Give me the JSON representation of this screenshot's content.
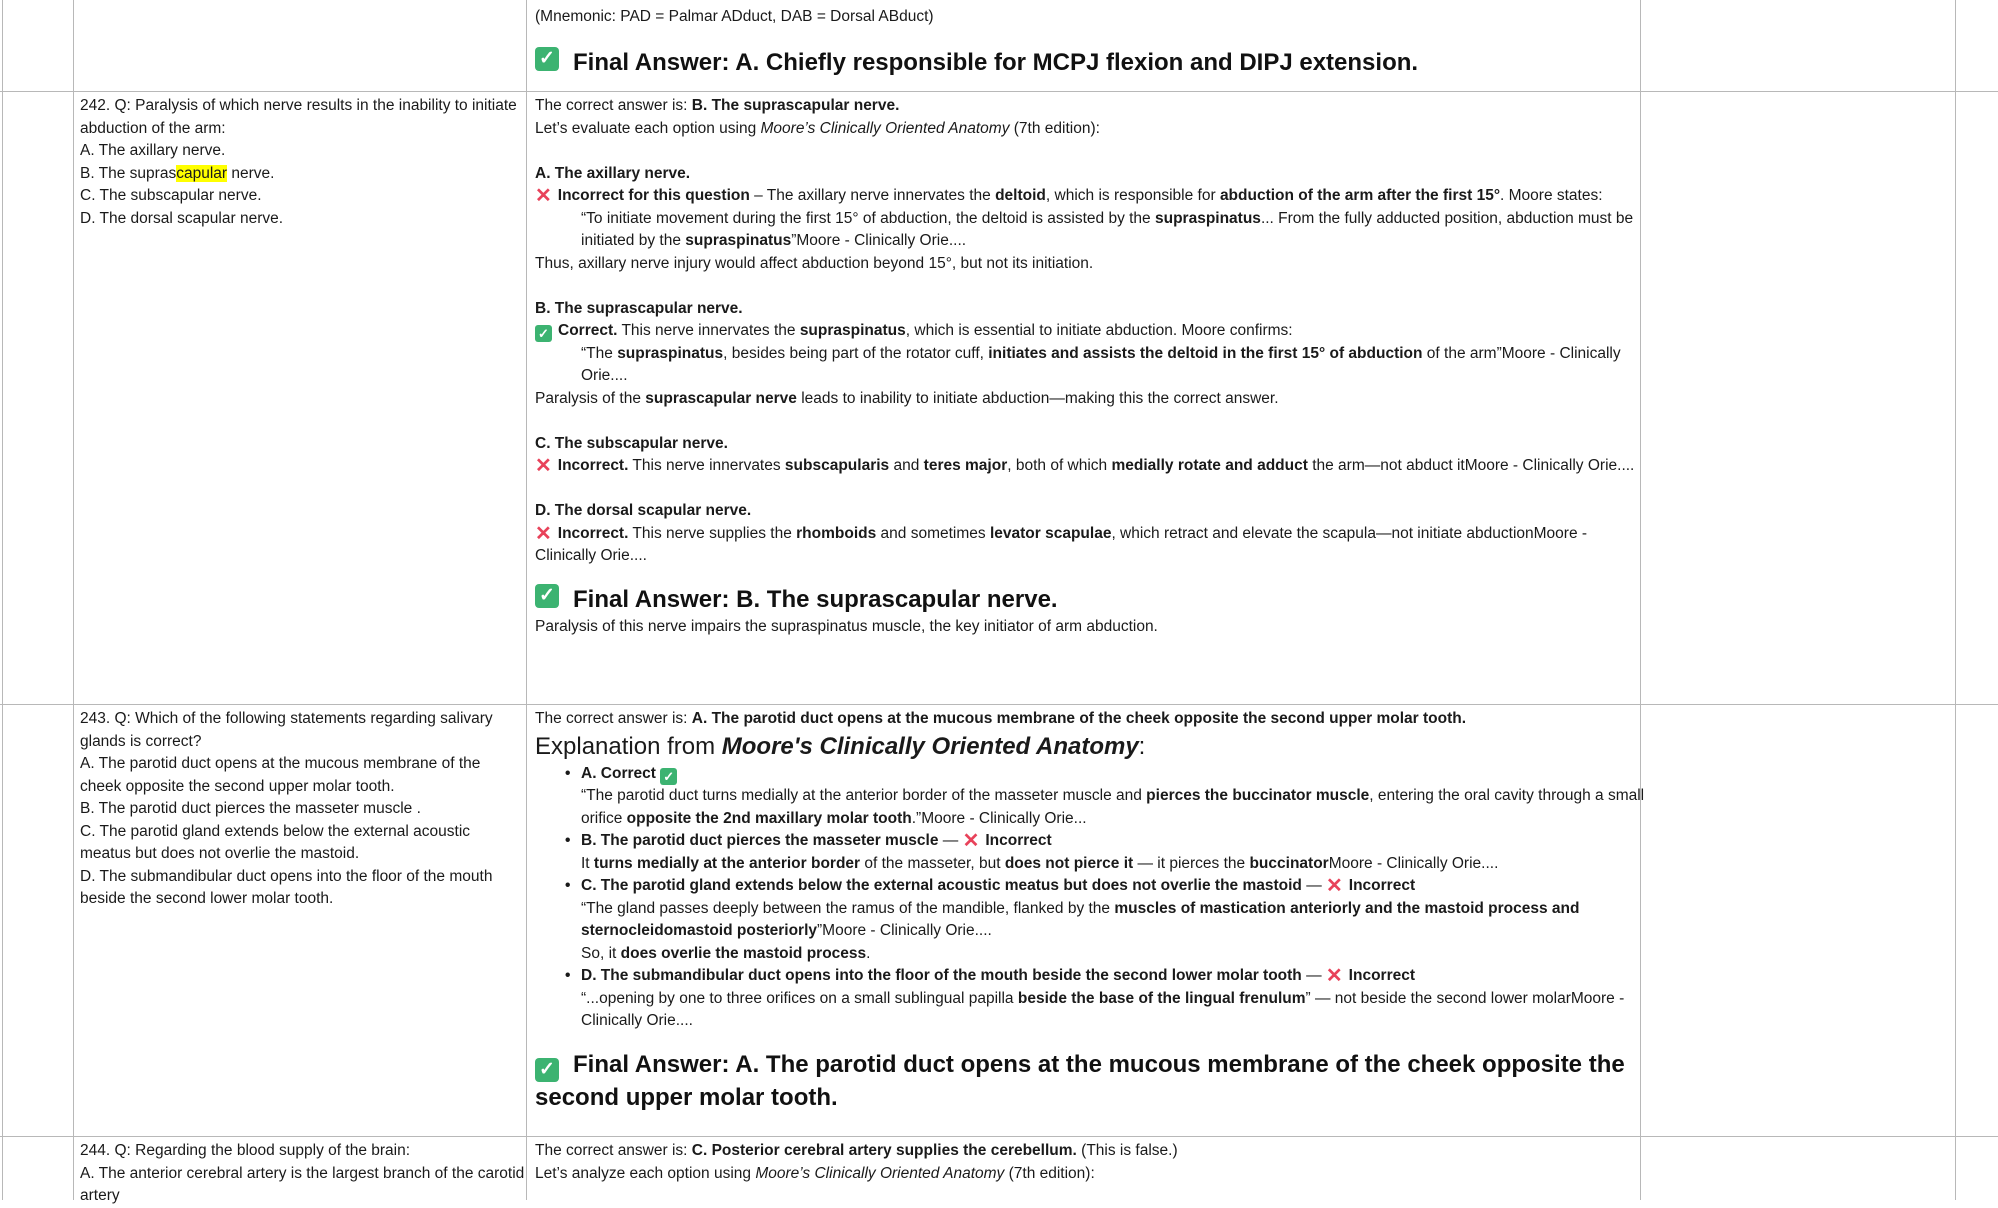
{
  "row241": {
    "mnemonic": "(Mnemonic: PAD = Palmar ADduct, DAB = Dorsal ABduct)",
    "final": "Final Answer: A. Chiefly responsible for MCPJ flexion and DIPJ extension."
  },
  "q242": {
    "stem": "242. Q: Paralysis of which nerve results in the inability to initiate abduction of the arm:",
    "opt_a": "A. The axillary nerve.",
    "opt_b_pre": "B. The supras",
    "opt_b_hl": "capular",
    "opt_b_post": " nerve.",
    "opt_c": "C. The subscapular nerve.",
    "opt_d": "D. The dorsal scapular nerve."
  },
  "a242": {
    "correct_pre": "The correct answer is: ",
    "correct_ans": "B. The suprascapular nerve.",
    "eval_pre": "Let’s evaluate each option using ",
    "eval_book": "Moore’s Clinically Oriented Anatomy",
    "eval_post": " (7th edition):",
    "a_head": "A. The axillary nerve.",
    "a_verdict": "Incorrect for this question",
    "a_t1": " – The axillary nerve innervates the ",
    "a_t2": "deltoid",
    "a_t3": ", which is responsible for ",
    "a_t4": "abduction of the arm after the first 15°",
    "a_t5": ". Moore states:",
    "a_q1": "“To initiate movement during the first 15° of abduction, the deltoid is assisted by the ",
    "a_q2": "supraspinatus",
    "a_q3": "... From the fully adducted position, abduction must be initiated by the ",
    "a_q4": "supraspinatus",
    "a_q5": "”Moore - Clinically Orie....",
    "a_thus": "Thus, axillary nerve injury would affect abduction beyond 15°, but not its initiation.",
    "b_head": "B. The suprascapular nerve.",
    "b_verdict": "Correct.",
    "b_t1": " This nerve innervates the ",
    "b_t2": "supraspinatus",
    "b_t3": ", which is essential to initiate abduction. Moore confirms:",
    "b_q1": "“The ",
    "b_q2": "supraspinatus",
    "b_q3": ", besides being part of the rotator cuff, ",
    "b_q4": "initiates and assists the deltoid in the first 15° of abduction",
    "b_q5": " of the arm”Moore - Clinically Orie....",
    "b_p1": "Paralysis of the ",
    "b_p2": "suprascapular nerve",
    "b_p3": " leads to inability to initiate abduction—making this the correct answer.",
    "c_head": "C. The subscapular nerve.",
    "c_verdict": "Incorrect.",
    "c_t1": " This nerve innervates ",
    "c_t2": "subscapularis",
    "c_t3": " and ",
    "c_t4": "teres major",
    "c_t5": ", both of which ",
    "c_t6": "medially rotate and adduct",
    "c_t7": " the arm—not abduct itMoore - Clinically Orie....",
    "d_head": "D. The dorsal scapular nerve.",
    "d_verdict": "Incorrect.",
    "d_t1": " This nerve supplies the ",
    "d_t2": "rhomboids",
    "d_t3": " and sometimes ",
    "d_t4": "levator scapulae",
    "d_t5": ", which retract and elevate the scapula—not initiate abductionMoore - Clinically Orie....",
    "final": "Final Answer: B. The suprascapular nerve.",
    "final_note": "Paralysis of this nerve impairs the supraspinatus muscle, the key initiator of arm abduction."
  },
  "q243": {
    "stem": "243. Q: Which of the following statements regarding salivary glands is correct?",
    "opt_a": "A. The parotid duct opens at the mucous membrane of the cheek opposite the second upper molar tooth.",
    "opt_b": "B. The parotid duct pierces the masseter muscle .",
    "opt_c": "C. The parotid gland extends below the external acoustic meatus but does not overlie the mastoid.",
    "opt_d": "D. The submandibular duct opens into the floor of the mouth beside the second lower molar tooth."
  },
  "a243": {
    "correct_pre": "The correct answer is: ",
    "correct_ans": "A. The parotid duct opens at the mucous membrane of the cheek opposite the second upper molar tooth.",
    "expl_pre": "Explanation from ",
    "expl_book": "Moore's Clinically Oriented Anatomy",
    "expl_post": ":",
    "a_head": "A. Correct",
    "a_q1": "“The parotid duct turns medially at the anterior border of the masseter muscle and ",
    "a_q2": "pierces the buccinator muscle",
    "a_q3": ", entering the oral cavity through a small orifice ",
    "a_q4": "opposite the 2nd maxillary molar tooth",
    "a_q5": ".”Moore - Clinically Orie...",
    "b_head": "B. The parotid duct pierces the masseter muscle",
    "b_dash": " — ",
    "b_verdict": "Incorrect",
    "b_q1": "It ",
    "b_q2": "turns medially at the anterior border",
    "b_q3": " of the masseter, but ",
    "b_q4": "does not pierce it",
    "b_q5": " — it pierces the ",
    "b_q6": "buccinator",
    "b_q7": "Moore - Clinically Orie....",
    "c_head": "C. The parotid gland extends below the external acoustic meatus but does not overlie the mastoid",
    "c_dash": " — ",
    "c_verdict": "Incorrect",
    "c_q1": "“The gland passes deeply between the ramus of the mandible, flanked by the ",
    "c_q2": "muscles of mastication anteriorly and the mastoid process and sternocleidomastoid posteriorly",
    "c_q3": "”Moore - Clinically Orie....",
    "c_so1": "So, it ",
    "c_so2": "does overlie the mastoid process",
    "c_so3": ".",
    "d_head": "D. The submandibular duct opens into the floor of the mouth beside the second lower molar tooth",
    "d_dash": " — ",
    "d_verdict": "Incorrect",
    "d_q1": "“...opening by one to three orifices on a small sublingual papilla ",
    "d_q2": "beside the base of the lingual frenulum",
    "d_q3": "” — not beside the second lower molarMoore - Clinically Orie....",
    "final": "Final Answer: A. The parotid duct opens at the mucous membrane of the cheek opposite the second upper molar tooth."
  },
  "q244": {
    "stem": "244. Q: Regarding the blood supply of the brain:",
    "opt_a": "A. The anterior cerebral artery is the largest branch of the carotid artery"
  },
  "a244": {
    "correct_pre": "The correct answer is: ",
    "correct_ans": "C. Posterior cerebral artery supplies the cerebellum.",
    "correct_post": " (This is false.)",
    "eval_pre": "Let’s analyze each option using ",
    "eval_book": "Moore’s Clinically Oriented Anatomy",
    "eval_post": " (7th edition):"
  }
}
